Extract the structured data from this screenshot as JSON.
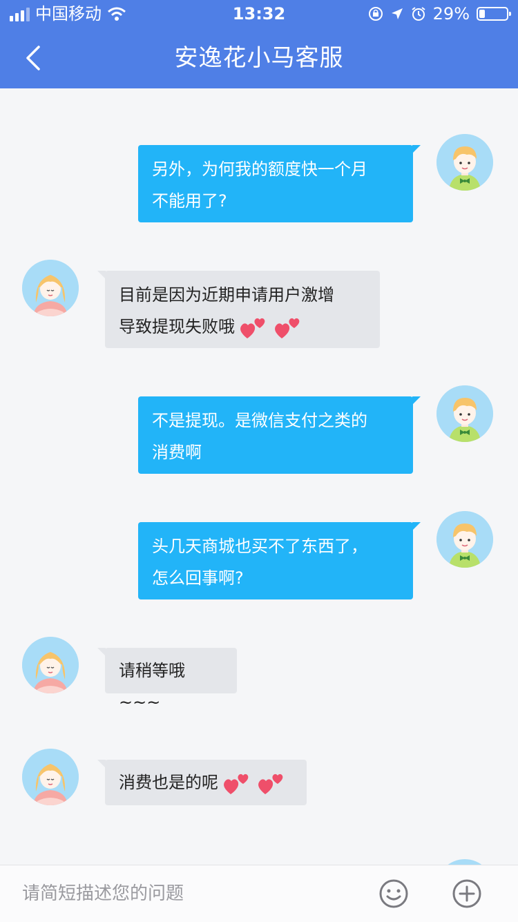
{
  "status_bar": {
    "carrier": "中国移动",
    "time": "13:32",
    "battery": "29%"
  },
  "header": {
    "title": "安逸花小马客服"
  },
  "messages": [
    {
      "sender": "user",
      "lines": [
        "另外，为何我的额度快一个月",
        "不能用了?"
      ]
    },
    {
      "sender": "agent",
      "lines": [
        "目前是因为近期申请用户激增",
        "导致提现失败哦"
      ],
      "emoji": "two-hearts"
    },
    {
      "sender": "user",
      "lines": [
        "不是提现。是微信支付之类的",
        "消费啊"
      ]
    },
    {
      "sender": "user",
      "lines": [
        "头几天商城也买不了东西了，",
        "怎么回事啊?"
      ]
    },
    {
      "sender": "agent",
      "lines": [
        "请稍等哦~~~"
      ]
    },
    {
      "sender": "agent",
      "lines": [
        "消费也是的呢"
      ],
      "emoji": "two-hearts"
    }
  ],
  "input": {
    "placeholder": "请简短描述您的问题"
  },
  "colors": {
    "header": "#4f7fe6",
    "user_bubble": "#22b4f8",
    "agent_bubble": "#e4e6ea",
    "background": "#f5f6f8"
  }
}
